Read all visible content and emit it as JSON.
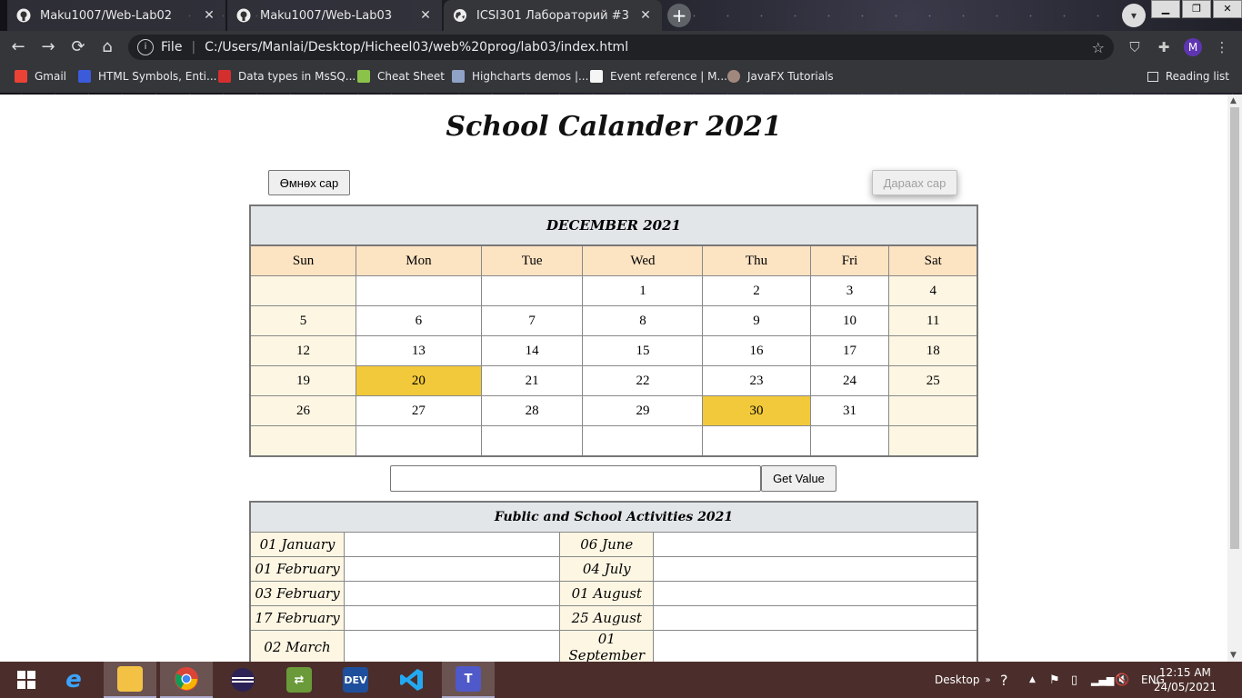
{
  "browser": {
    "tabs": [
      {
        "title": "Maku1007/Web-Lab02",
        "icon": "github-icon",
        "active": false
      },
      {
        "title": "Maku1007/Web-Lab03",
        "icon": "github-icon",
        "active": false
      },
      {
        "title": "ICSI301 Лабораторий #3",
        "icon": "globe-icon",
        "active": true
      }
    ],
    "new_tab_label": "+",
    "address": {
      "scheme_label": "File",
      "url": "C:/Users/Manlai/Desktop/Hicheel03/web%20prog/lab03/index.html"
    },
    "profile_initial": "M",
    "bookmarks": [
      {
        "label": "Gmail",
        "color": "#ea4335"
      },
      {
        "label": "HTML Symbols, Enti...",
        "color": "#3b5bdb"
      },
      {
        "label": "Data types in MsSQ...",
        "color": "#d32f2f"
      },
      {
        "label": "Cheat Sheet",
        "color": "#8bc34a"
      },
      {
        "label": "Highcharts demos |...",
        "color": "#8ea3c6"
      },
      {
        "label": "Event reference | M...",
        "color": "#f5f5f5"
      },
      {
        "label": "JavaFX Tutorials",
        "color": "#a1887f"
      }
    ],
    "reading_list": "Reading list"
  },
  "page": {
    "title": "School Calander 2021",
    "prev_button": "Өмнөх сар",
    "next_button": "Дараах сар",
    "calendar": {
      "month_title": "DECEMBER 2021",
      "days_of_week": [
        "Sun",
        "Mon",
        "Tue",
        "Wed",
        "Thu",
        "Fri",
        "Sat"
      ],
      "weeks": [
        [
          "",
          "",
          "",
          "1",
          "2",
          "3",
          "4"
        ],
        [
          "5",
          "6",
          "7",
          "8",
          "9",
          "10",
          "11"
        ],
        [
          "12",
          "13",
          "14",
          "15",
          "16",
          "17",
          "18"
        ],
        [
          "19",
          "20",
          "21",
          "22",
          "23",
          "24",
          "25"
        ],
        [
          "26",
          "27",
          "28",
          "29",
          "30",
          "31",
          ""
        ],
        [
          "",
          "",
          "",
          "",
          "",
          "",
          ""
        ]
      ],
      "highlighted_days": [
        "20",
        "30"
      ],
      "highlight_color": "#f2c93a",
      "weekend_color": "#fdf6e3",
      "header_row_color": "#fce3c2"
    },
    "value_input": {
      "value": "",
      "placeholder": ""
    },
    "get_value_button": "Get Value",
    "activities": {
      "title": "Fublic and School Activities 2021",
      "rows": [
        {
          "left_date": "01 January",
          "left_desc": "",
          "right_date": "06 June",
          "right_desc": ""
        },
        {
          "left_date": "01 February",
          "left_desc": "",
          "right_date": "04 July",
          "right_desc": ""
        },
        {
          "left_date": "03 February",
          "left_desc": "",
          "right_date": "01 August",
          "right_desc": ""
        },
        {
          "left_date": "17 February",
          "left_desc": "",
          "right_date": "25 August",
          "right_desc": ""
        },
        {
          "left_date": "02 March",
          "left_desc": "",
          "right_date": "01 September",
          "right_desc": ""
        }
      ]
    }
  },
  "taskbar": {
    "apps": [
      "windows-start-icon",
      "internet-explorer-icon",
      "file-explorer-icon",
      "chrome-icon",
      "eclipse-icon",
      "arrows-app-icon",
      "dev-cpp-icon",
      "vscode-icon",
      "teams-icon"
    ],
    "dev_label": "DEV",
    "desktop_label": "Desktop",
    "language": "ENG",
    "time": "12:15 AM",
    "date": "24/05/2021"
  }
}
